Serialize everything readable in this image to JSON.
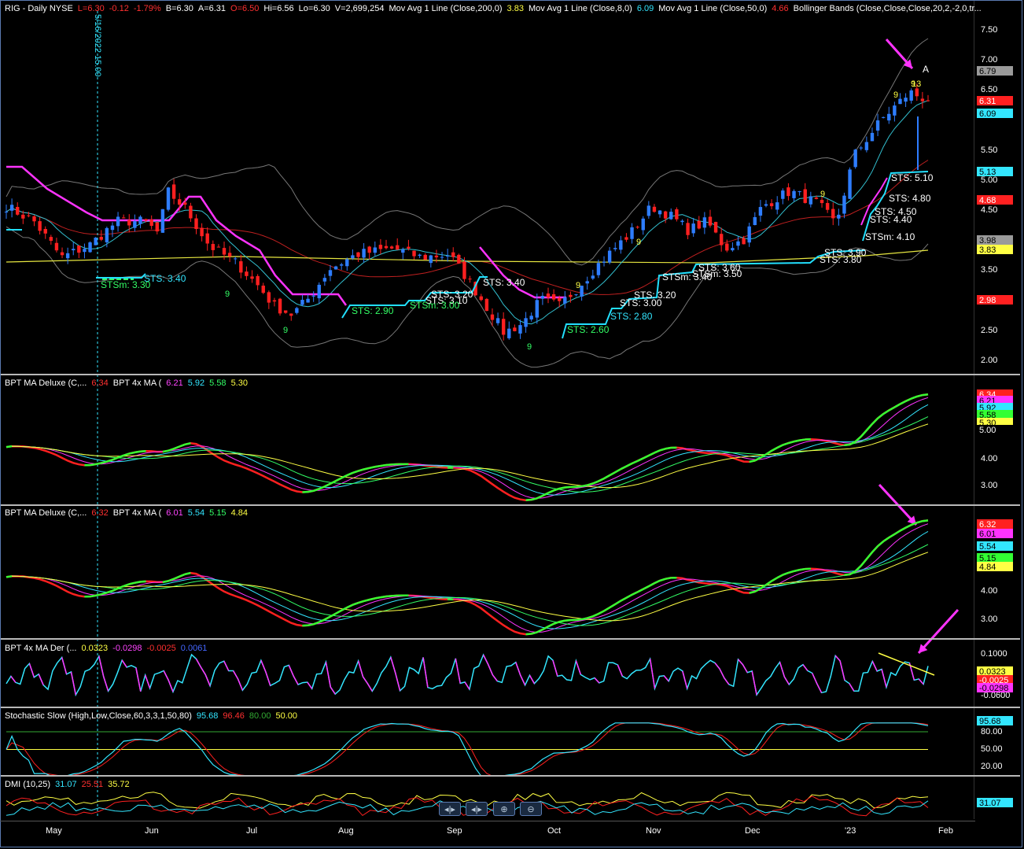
{
  "colors": {
    "bg": "#000000",
    "up": "#2e7dff",
    "down": "#ff2020",
    "sts": "#22e0ff",
    "bull": "#33ff33",
    "bear": "#ff2020",
    "magenta": "#ff33ff",
    "yellow": "#ffff44",
    "cyan": "#33e6ff",
    "gray": "#8a8a8a",
    "green_text": "#33ff66"
  },
  "main": {
    "header": [
      {
        "text": "RIG - Daily  NYSE",
        "color": "#ffffff"
      },
      {
        "text": "L=6.30",
        "color": "#ff3030"
      },
      {
        "text": "-0.12",
        "color": "#ff3030"
      },
      {
        "text": "-1.79%",
        "color": "#ff3030"
      },
      {
        "text": "B=6.30",
        "color": "#ffffff"
      },
      {
        "text": "A=6.31",
        "color": "#ffffff"
      },
      {
        "text": "O=6.50",
        "color": "#ff3030"
      },
      {
        "text": "Hi=6.56",
        "color": "#ffffff"
      },
      {
        "text": "Lo=6.30",
        "color": "#ffffff"
      },
      {
        "text": "V=2,699,254",
        "color": "#ffffff"
      },
      {
        "text": "Mov Avg 1 Line (Close,200,0)",
        "color": "#ffffff"
      },
      {
        "text": "3.83",
        "color": "#ffff44"
      },
      {
        "text": "Mov Avg 1 Line (Close,8,0)",
        "color": "#ffffff"
      },
      {
        "text": "6.09",
        "color": "#33e6ff"
      },
      {
        "text": "Mov Avg 1 Line (Close,50,0)",
        "color": "#ffffff"
      },
      {
        "text": "4.66",
        "color": "#ff3030"
      },
      {
        "text": "Bollinger Bands (Close,Close,Close,20,2,-2,0,tr...",
        "color": "#ffffff"
      }
    ],
    "cursor_label": "5/16/2022 15.00",
    "marker_A": "A",
    "y_ticks": [
      "7.50",
      "7.00",
      "6.50",
      "5.50",
      "5.00",
      "4.50",
      "3.50",
      "2.50",
      "2.00"
    ],
    "price_tags": [
      {
        "value": "6.79",
        "color": "#9a9a9a",
        "text_color": "#000000"
      },
      {
        "value": "6.31",
        "color": "#ff2020",
        "text_color": "#ffffff"
      },
      {
        "value": "6.09",
        "color": "#33e6ff",
        "text_color": "#000000"
      },
      {
        "value": "5.13",
        "color": "#33e6ff",
        "text_color": "#000000"
      },
      {
        "value": "4.68",
        "color": "#ff2020",
        "text_color": "#ffffff"
      },
      {
        "value": "3.98",
        "color": "#9a9a9a",
        "text_color": "#000000"
      },
      {
        "value": "3.83",
        "color": "#ffff44",
        "text_color": "#000000"
      },
      {
        "value": "2.98",
        "color": "#ff2020",
        "text_color": "#ffffff"
      }
    ],
    "sts_labels": [
      {
        "text": "STS: 3.40",
        "color": "#33e6ff"
      },
      {
        "text": "STSm: 3.30",
        "color": "#33ff66"
      },
      {
        "text": "STS: 2.90",
        "color": "#33ff66"
      },
      {
        "text": "STS: 3.20",
        "color": "#ffffff"
      },
      {
        "text": "STS: 3.10",
        "color": "#ffffff"
      },
      {
        "text": "STSm: 3.00",
        "color": "#33ff66"
      },
      {
        "text": "STS: 3.40",
        "color": "#ffffff"
      },
      {
        "text": "STS: 2.60",
        "color": "#33ff66"
      },
      {
        "text": "STS: 2.80",
        "color": "#33e6ff"
      },
      {
        "text": "STS: 3.00",
        "color": "#ffffff"
      },
      {
        "text": "STS: 3.20",
        "color": "#ffffff"
      },
      {
        "text": "STSm: 3.40",
        "color": "#ffffff"
      },
      {
        "text": "STS: 3.60",
        "color": "#ffffff"
      },
      {
        "text": "STSm: 3.50",
        "color": "#ffffff"
      },
      {
        "text": "STS: 3.90",
        "color": "#ffffff"
      },
      {
        "text": "STS: 3.80",
        "color": "#ffffff"
      },
      {
        "text": "STSm: 4.10",
        "color": "#ffffff"
      },
      {
        "text": "STS: 4.40",
        "color": "#ffffff"
      },
      {
        "text": "STS: 4.50",
        "color": "#ffffff"
      },
      {
        "text": "STS: 4.80",
        "color": "#ffffff"
      },
      {
        "text": "STS: 5.10",
        "color": "#ffffff"
      }
    ],
    "count_labels": [
      {
        "text": "9",
        "color": "#33ff66"
      },
      {
        "text": "9",
        "color": "#33ff66"
      },
      {
        "text": "9",
        "color": "#ffff44"
      },
      {
        "text": "9",
        "color": "#ffff44"
      },
      {
        "text": "9",
        "color": "#33ff66"
      },
      {
        "text": "9",
        "color": "#ffff44"
      },
      {
        "text": "9",
        "color": "#ffff44"
      },
      {
        "text": "9",
        "color": "#ffff44"
      },
      {
        "text": "13",
        "color": "#ffff44"
      }
    ]
  },
  "pane2": {
    "header": [
      {
        "text": "BPT MA Deluxe (C,...",
        "color": "#ffffff"
      },
      {
        "text": "6.34",
        "color": "#ff3030"
      },
      {
        "text": "BPT 4x MA (",
        "color": "#ffffff"
      },
      {
        "text": "6.21",
        "color": "#ff44ff"
      },
      {
        "text": "5.92",
        "color": "#33e6ff"
      },
      {
        "text": "5.58",
        "color": "#33ff66"
      },
      {
        "text": "5.30",
        "color": "#ffff44"
      }
    ],
    "y_ticks": [
      "4.00",
      "3.00"
    ],
    "tags": [
      {
        "value": "6.34",
        "color": "#ff2020",
        "text_color": "#ffffff"
      },
      {
        "value": "6.21",
        "color": "#ff33ff",
        "text_color": "#000000"
      },
      {
        "value": "5.92",
        "color": "#33e6ff",
        "text_color": "#000000"
      },
      {
        "value": "5.58",
        "color": "#33ff33",
        "text_color": "#000000"
      },
      {
        "value": "5.30",
        "color": "#ffff44",
        "text_color": "#000000"
      },
      {
        "value": "5.00",
        "color": "#000000",
        "text_color": "#ffffff"
      }
    ]
  },
  "pane3": {
    "header": [
      {
        "text": "BPT MA Deluxe (C,...",
        "color": "#ffffff"
      },
      {
        "text": "6.32",
        "color": "#ff3030"
      },
      {
        "text": "BPT 4x MA (",
        "color": "#ffffff"
      },
      {
        "text": "6.01",
        "color": "#ff44ff"
      },
      {
        "text": "5.54",
        "color": "#33e6ff"
      },
      {
        "text": "5.15",
        "color": "#33ff66"
      },
      {
        "text": "4.84",
        "color": "#ffff44"
      }
    ],
    "y_ticks": [
      "4.00",
      "3.00"
    ],
    "tags": [
      {
        "value": "6.32",
        "color": "#ff2020",
        "text_color": "#ffffff"
      },
      {
        "value": "6.01",
        "color": "#ff33ff",
        "text_color": "#000000"
      },
      {
        "value": "5.54",
        "color": "#33e6ff",
        "text_color": "#000000"
      },
      {
        "value": "5.15",
        "color": "#33ff33",
        "text_color": "#000000"
      },
      {
        "value": "4.84",
        "color": "#ffff44",
        "text_color": "#000000"
      }
    ]
  },
  "pane4": {
    "header": [
      {
        "text": "BPT 4x MA Der (...",
        "color": "#ffffff"
      },
      {
        "text": "0.0323",
        "color": "#ffff44"
      },
      {
        "text": "-0.0298",
        "color": "#ff44ff"
      },
      {
        "text": "-0.0025",
        "color": "#ff3030"
      },
      {
        "text": "0.0061",
        "color": "#4466ff"
      }
    ],
    "y_ticks": [
      "0.1000",
      "-0.0600"
    ],
    "tags": [
      {
        "value": "0.0323",
        "color": "#ffff44",
        "text_color": "#000000"
      },
      {
        "value": "-0.0025",
        "color": "#ff2020",
        "text_color": "#ffffff"
      },
      {
        "value": "-0.0298",
        "color": "#ff33ff",
        "text_color": "#000000"
      }
    ]
  },
  "pane5": {
    "header": [
      {
        "text": "Stochastic Slow (High,Low,Close,60,3,3,1,50,80)",
        "color": "#ffffff"
      },
      {
        "text": "95.68",
        "color": "#33e6ff"
      },
      {
        "text": "96.46",
        "color": "#ff3030"
      },
      {
        "text": "80.00",
        "color": "#33aa33"
      },
      {
        "text": "50.00",
        "color": "#ffff44"
      }
    ],
    "y_ticks": [
      "80.00",
      "50.00",
      "20.00"
    ],
    "tags": [
      {
        "value": "95.68",
        "color": "#33e6ff",
        "text_color": "#000000"
      }
    ]
  },
  "pane6": {
    "header": [
      {
        "text": "DMI (10,25)",
        "color": "#ffffff"
      },
      {
        "text": "31.07",
        "color": "#33e6ff"
      },
      {
        "text": "25.51",
        "color": "#ff3030"
      },
      {
        "text": "35.72",
        "color": "#ffff44"
      }
    ],
    "tags": [
      {
        "value": "31.07",
        "color": "#33e6ff",
        "text_color": "#000000"
      }
    ]
  },
  "x_axis": [
    "May",
    "Jun",
    "Jul",
    "Aug",
    "Sep",
    "Oct",
    "Nov",
    "Dec",
    "'23",
    "Feb"
  ],
  "toolbar": {
    "scroll_left": "◂|▸",
    "scroll_right": "◂|▸",
    "zoom_in": "⊕",
    "zoom_out": "⊖"
  }
}
